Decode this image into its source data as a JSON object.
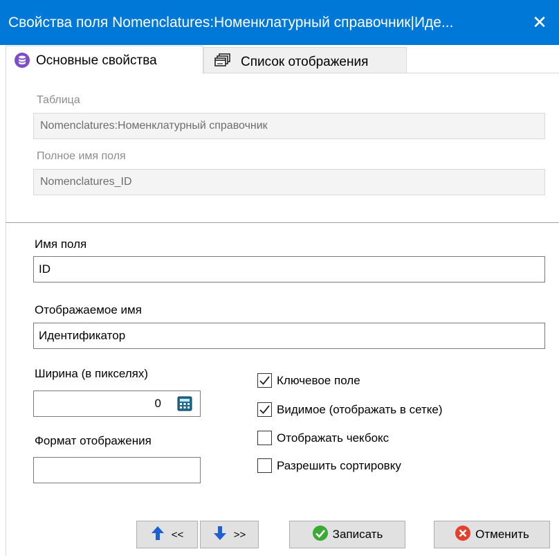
{
  "window": {
    "title": "Свойства поля Nomenclatures:Номенклатурный справочник|Иде...",
    "close_glyph": "✕"
  },
  "tabs": [
    {
      "label": "Основные свойства",
      "icon": "database-purple-icon",
      "active": true
    },
    {
      "label": "Список отображения",
      "icon": "stacked-windows-icon",
      "active": false
    }
  ],
  "readonly": {
    "table_label": "Таблица",
    "table_value": "Nomenclatures:Номенклатурный справочник",
    "fullname_label": "Полное имя поля",
    "fullname_value": "Nomenclatures_ID"
  },
  "form": {
    "field_name_label": "Имя поля",
    "field_name_value": "ID",
    "display_name_label": "Отображаемое имя",
    "display_name_value": "Идентификатор",
    "width_label": "Ширина (в пикселях)",
    "width_value": "0",
    "format_label": "Формат отображения",
    "format_value": ""
  },
  "checkboxes": [
    {
      "label": "Ключевое поле",
      "checked": true
    },
    {
      "label": "Видимое (отображать в сетке)",
      "checked": true
    },
    {
      "label": "Отображать чекбокс",
      "checked": false
    },
    {
      "label": "Разрешить сортировку",
      "checked": false
    }
  ],
  "buttons": {
    "prev_label": "<<",
    "next_label": ">>",
    "save_label": "Записать",
    "cancel_label": "Отменить"
  },
  "colors": {
    "titlebar": "#0078d7",
    "tab_icon": "#7b4fc9",
    "arrow": "#1f5fd6",
    "save_icon": "#3aaa35",
    "cancel_icon": "#e2412f"
  }
}
